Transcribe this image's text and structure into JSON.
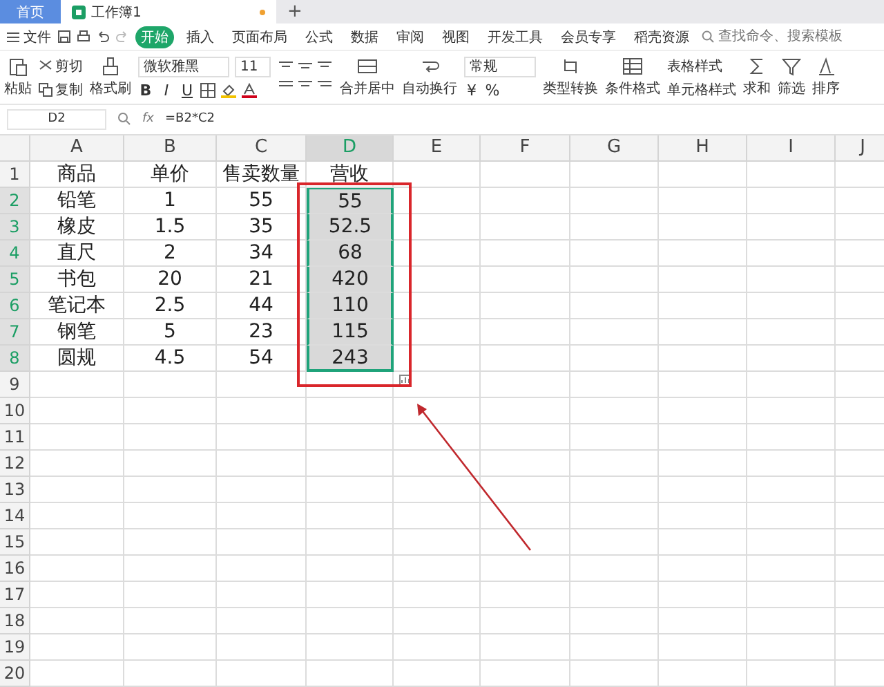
{
  "tabs": [
    {
      "label": "首页",
      "kind": "home",
      "selected": false
    },
    {
      "label": "工作簿1",
      "kind": "doc",
      "selected": true
    }
  ],
  "new_tab": "+",
  "menu": {
    "file": "文件",
    "tabs": [
      {
        "label": "开始",
        "selected": true
      },
      {
        "label": "插入",
        "selected": false
      },
      {
        "label": "页面布局",
        "selected": false
      },
      {
        "label": "公式",
        "selected": false
      },
      {
        "label": "数据",
        "selected": false
      },
      {
        "label": "审阅",
        "selected": false
      },
      {
        "label": "视图",
        "selected": false
      },
      {
        "label": "开发工具",
        "selected": false
      },
      {
        "label": "会员专享",
        "selected": false
      },
      {
        "label": "稻壳资源",
        "selected": false
      }
    ],
    "search_placeholder": "查找命令、搜索模板"
  },
  "toolbar": {
    "paste": "粘贴",
    "cut": "剪切",
    "copy": "复制",
    "format_painter": "格式刷",
    "font": "微软雅黑",
    "font_size": "11",
    "bold": "B",
    "italic": "I",
    "underline": "U",
    "merge": "合并居中",
    "wrap": "自动换行",
    "number_format": "常规",
    "currency": "¥",
    "percent": "%",
    "convert": "类型转换",
    "conditional": "条件格式",
    "table_style": "表格样式",
    "cell_style": "单元格样式",
    "sum": "求和",
    "filter": "筛选",
    "sort": "排序"
  },
  "formula_bar": {
    "cell_ref": "D2",
    "fx": "fx",
    "formula": "=B2*C2"
  },
  "columns": [
    {
      "label": "A",
      "selected": false
    },
    {
      "label": "B",
      "selected": false
    },
    {
      "label": "C",
      "selected": false
    },
    {
      "label": "D",
      "selected": true
    },
    {
      "label": "E",
      "selected": false
    },
    {
      "label": "F",
      "selected": false
    },
    {
      "label": "G",
      "selected": false
    },
    {
      "label": "H",
      "selected": false
    },
    {
      "label": "I",
      "selected": false
    },
    {
      "label": "J",
      "selected": false
    }
  ],
  "rows": [
    {
      "number": "1",
      "selected": false,
      "cells": [
        "商品",
        "单价",
        "售卖数量",
        "营收"
      ]
    },
    {
      "number": "2",
      "selected": true,
      "cells": [
        "铅笔",
        "1",
        "55",
        "55"
      ]
    },
    {
      "number": "3",
      "selected": true,
      "cells": [
        "橡皮",
        "1.5",
        "35",
        "52.5"
      ]
    },
    {
      "number": "4",
      "selected": true,
      "cells": [
        "直尺",
        "2",
        "34",
        "68"
      ]
    },
    {
      "number": "5",
      "selected": true,
      "cells": [
        "书包",
        "20",
        "21",
        "420"
      ]
    },
    {
      "number": "6",
      "selected": true,
      "cells": [
        "笔记本",
        "2.5",
        "44",
        "110"
      ]
    },
    {
      "number": "7",
      "selected": true,
      "cells": [
        "钢笔",
        "5",
        "23",
        "115"
      ]
    },
    {
      "number": "8",
      "selected": true,
      "cells": [
        "圆规",
        "4.5",
        "54",
        "243"
      ]
    },
    {
      "number": "9",
      "selected": false
    },
    {
      "number": "10",
      "selected": false
    },
    {
      "number": "11",
      "selected": false
    },
    {
      "number": "12",
      "selected": false
    },
    {
      "number": "13",
      "selected": false
    },
    {
      "number": "14",
      "selected": false
    },
    {
      "number": "15",
      "selected": false
    },
    {
      "number": "16",
      "selected": false
    },
    {
      "number": "17",
      "selected": false
    },
    {
      "number": "18",
      "selected": false
    },
    {
      "number": "19",
      "selected": false
    },
    {
      "number": "20",
      "selected": false
    }
  ]
}
